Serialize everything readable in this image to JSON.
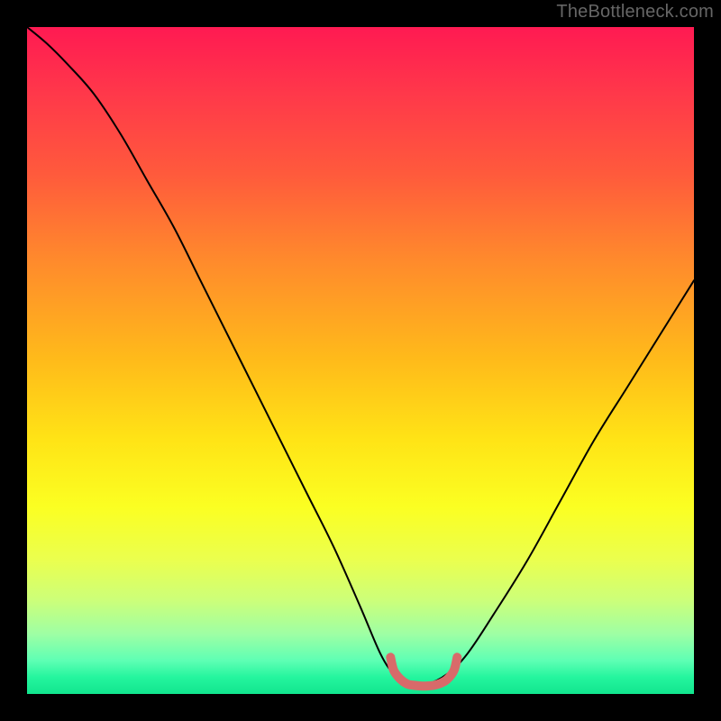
{
  "watermark": "TheBottleneck.com",
  "chart_data": {
    "type": "line",
    "title": "",
    "xlabel": "",
    "ylabel": "",
    "xlim": [
      0,
      1
    ],
    "ylim": [
      0,
      1
    ],
    "legend": false,
    "series": [
      {
        "name": "bottleneck-curve",
        "x": [
          0.0,
          0.03,
          0.06,
          0.1,
          0.14,
          0.18,
          0.22,
          0.26,
          0.3,
          0.34,
          0.38,
          0.42,
          0.46,
          0.5,
          0.53,
          0.55,
          0.57,
          0.6,
          0.63,
          0.66,
          0.7,
          0.75,
          0.8,
          0.85,
          0.9,
          0.95,
          1.0
        ],
        "y": [
          1.0,
          0.975,
          0.945,
          0.9,
          0.84,
          0.77,
          0.7,
          0.62,
          0.54,
          0.46,
          0.38,
          0.3,
          0.22,
          0.13,
          0.06,
          0.03,
          0.015,
          0.015,
          0.03,
          0.06,
          0.12,
          0.2,
          0.29,
          0.38,
          0.46,
          0.54,
          0.62
        ],
        "stroke": "#000000",
        "stroke_width": 2.0
      },
      {
        "name": "optimal-zone",
        "x": [
          0.545,
          0.55,
          0.56,
          0.57,
          0.58,
          0.59,
          0.6,
          0.61,
          0.62,
          0.63,
          0.64,
          0.645
        ],
        "y": [
          0.055,
          0.035,
          0.022,
          0.015,
          0.013,
          0.012,
          0.012,
          0.013,
          0.016,
          0.022,
          0.035,
          0.055
        ],
        "stroke": "#d86a6a",
        "stroke_width": 10
      }
    ],
    "background_gradient": {
      "stops": [
        {
          "offset": 0.0,
          "color": "#ff1a52"
        },
        {
          "offset": 0.1,
          "color": "#ff384a"
        },
        {
          "offset": 0.22,
          "color": "#ff5a3c"
        },
        {
          "offset": 0.35,
          "color": "#ff8a2c"
        },
        {
          "offset": 0.5,
          "color": "#ffbb1a"
        },
        {
          "offset": 0.62,
          "color": "#ffe416"
        },
        {
          "offset": 0.72,
          "color": "#fbff22"
        },
        {
          "offset": 0.8,
          "color": "#eaff4f"
        },
        {
          "offset": 0.86,
          "color": "#ccff7a"
        },
        {
          "offset": 0.91,
          "color": "#9effa4"
        },
        {
          "offset": 0.95,
          "color": "#5effb4"
        },
        {
          "offset": 0.975,
          "color": "#24f59e"
        },
        {
          "offset": 1.0,
          "color": "#12e58e"
        }
      ]
    }
  }
}
